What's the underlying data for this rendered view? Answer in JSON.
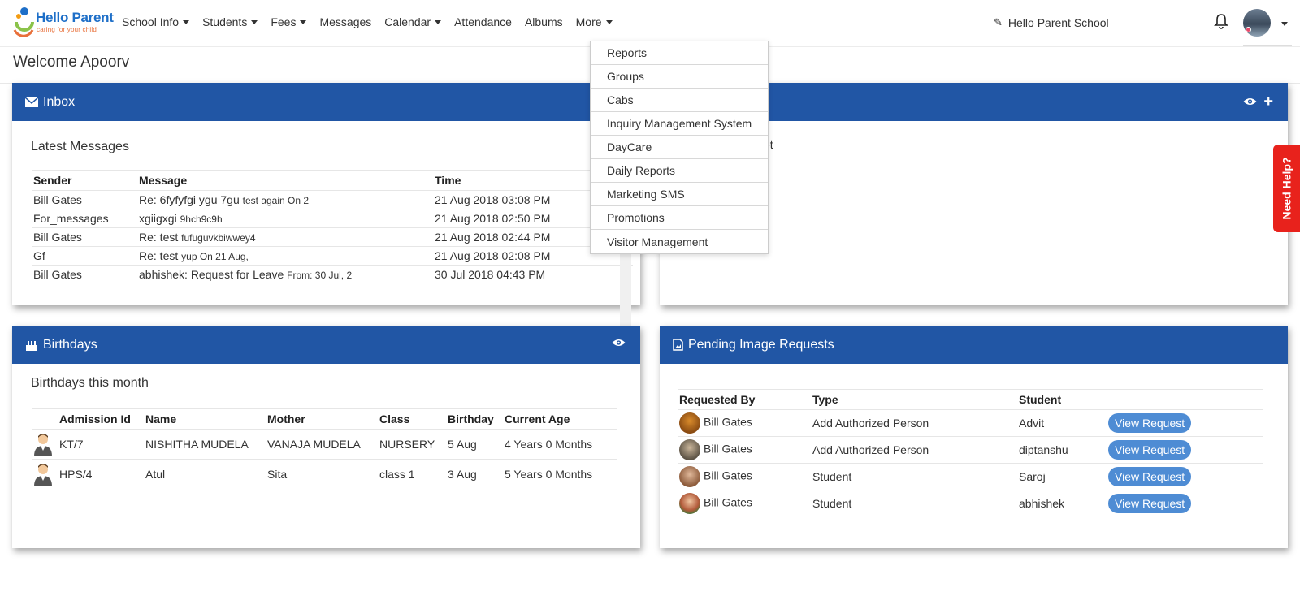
{
  "brand": {
    "name": "Hello Parent",
    "tagline": "caring for your child"
  },
  "nav": {
    "items": [
      "School Info",
      "Students",
      "Fees",
      "Messages",
      "Calendar",
      "Attendance",
      "Albums",
      "More"
    ],
    "school_name": "Hello Parent School"
  },
  "welcome": "Welcome Apoorv",
  "more_menu": [
    "Reports",
    "Groups",
    "Cabs",
    "Inquiry Management System",
    "DayCare",
    "Daily Reports",
    "Marketing SMS",
    "Promotions",
    "Visitor Management"
  ],
  "inbox": {
    "title": "Inbox",
    "subtitle": "Latest Messages",
    "columns": [
      "Sender",
      "Message",
      "Time"
    ],
    "rows": [
      {
        "sender": "Bill Gates",
        "message": "Re: 6fyfyfgi ygu 7gu",
        "preview": "test again On 2",
        "time": "21 Aug 2018 03:08 PM"
      },
      {
        "sender": "For_messages",
        "message": "xgiigxgi",
        "preview": "9hch9c9h",
        "time": "21 Aug 2018 02:50 PM"
      },
      {
        "sender": "Bill Gates",
        "message": "Re: test",
        "preview": "fufuguvkbiwwey4",
        "time": "21 Aug 2018 02:44 PM"
      },
      {
        "sender": "Gf",
        "message": "Re: test",
        "preview": "yup On 21 Aug,",
        "time": "21 Aug 2018 02:08 PM"
      },
      {
        "sender": "Bill Gates",
        "message": "abhishek: Request for Leave",
        "preview": "From: 30 Jul, 2",
        "time": "30 Jul 2018 04:43 PM"
      }
    ]
  },
  "right_top": {
    "partial_text": "et"
  },
  "birthdays": {
    "title": "Birthdays",
    "subtitle": "Birthdays this month",
    "columns": [
      "Admission Id",
      "Name",
      "Mother",
      "Class",
      "Birthday",
      "Current Age"
    ],
    "rows": [
      {
        "admission_id": "KT/7",
        "name": "NISHITHA MUDELA",
        "mother": "VANAJA MUDELA",
        "class": "NURSERY",
        "birthday": "5 Aug",
        "age": "4 Years 0 Months"
      },
      {
        "admission_id": "HPS/4",
        "name": "Atul",
        "mother": "Sita",
        "class": "class 1",
        "birthday": "3 Aug",
        "age": "5 Years 0 Months"
      }
    ]
  },
  "pending": {
    "title": "Pending Image Requests",
    "columns": [
      "Requested By",
      "Type",
      "Student"
    ],
    "button_label": "View Request",
    "rows": [
      {
        "by": "Bill Gates",
        "type": "Add Authorized Person",
        "student": "Advit"
      },
      {
        "by": "Bill Gates",
        "type": "Add Authorized Person",
        "student": "diptanshu"
      },
      {
        "by": "Bill Gates",
        "type": "Student",
        "student": "Saroj"
      },
      {
        "by": "Bill Gates",
        "type": "Student",
        "student": "abhishek"
      }
    ]
  },
  "help_tab": "Need Help?",
  "colors": {
    "header_blue": "#2156a5",
    "button_blue": "#4e8cd4",
    "help_red": "#e8221c",
    "brand_blue": "#1e6fc8"
  }
}
